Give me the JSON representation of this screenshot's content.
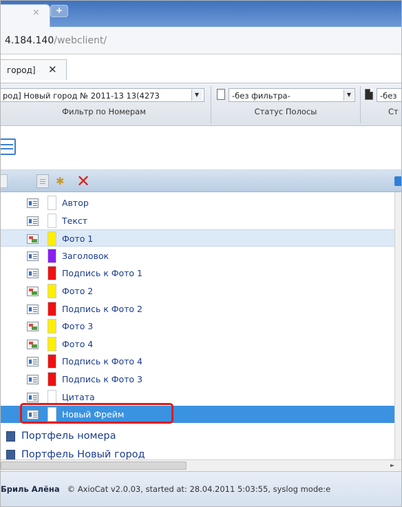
{
  "browser": {
    "tab_close_glyph": "×",
    "new_tab_glyph": "+",
    "url_host": "4.184.140",
    "url_path": "/webclient/"
  },
  "app_tab": {
    "label": "город]",
    "close_glyph": "✕"
  },
  "filters": {
    "issue_value": "род] Новый город № 2011-13 13(4273",
    "issue_label": "Фильтр по Номерам",
    "status_value": "-без фильтра-",
    "status_label": "Статус Полосы",
    "third_value": "-без",
    "third_label": "Ст"
  },
  "toolbar": {
    "delete_glyph": "✕",
    "new_glyph": "✱"
  },
  "tree": {
    "items": [
      {
        "label": "Автор",
        "icon": "text-frame-icon",
        "color": "#ffffff",
        "state": "normal"
      },
      {
        "label": "Текст",
        "icon": "text-frame-icon",
        "color": "#ffffff",
        "state": "normal"
      },
      {
        "label": "Фото 1",
        "icon": "photo-frame-icon",
        "color": "#ffee00",
        "state": "hover"
      },
      {
        "label": "Заголовок",
        "icon": "text-frame-icon",
        "color": "#8a1ef0",
        "state": "normal"
      },
      {
        "label": "Подпись к Фото 1",
        "icon": "text-frame-icon",
        "color": "#ee1111",
        "state": "normal"
      },
      {
        "label": "Фото 2",
        "icon": "photo-frame-icon",
        "color": "#ffee00",
        "state": "normal"
      },
      {
        "label": "Подпись к Фото 2",
        "icon": "text-frame-icon",
        "color": "#ee1111",
        "state": "normal"
      },
      {
        "label": "Фото 3",
        "icon": "photo-frame-icon",
        "color": "#ffee00",
        "state": "normal"
      },
      {
        "label": "Фото 4",
        "icon": "photo-frame-icon",
        "color": "#ffee00",
        "state": "normal"
      },
      {
        "label": "Подпись к Фото 4",
        "icon": "text-frame-icon",
        "color": "#ee1111",
        "state": "normal"
      },
      {
        "label": "Подпись к Фото 3",
        "icon": "text-frame-icon",
        "color": "#ee1111",
        "state": "normal"
      },
      {
        "label": "Цитата",
        "icon": "text-frame-icon",
        "color": "#ffffff",
        "state": "normal"
      },
      {
        "label": "Новый Фрейм",
        "icon": "text-frame-icon",
        "color": "#ffffff",
        "state": "selected"
      }
    ],
    "sections": [
      {
        "label": "Портфель номера"
      },
      {
        "label": "Портфель Новый город"
      }
    ]
  },
  "status": {
    "user": "Бриль Алёна",
    "text": "© AxioCat v2.0.03, started at: 28.04.2011 5:03:55, syslog mode:e"
  },
  "colors": {
    "accent_selected": "#3a92e0",
    "highlight_box": "#e01a1a",
    "tree_text": "#1a3c8e"
  }
}
